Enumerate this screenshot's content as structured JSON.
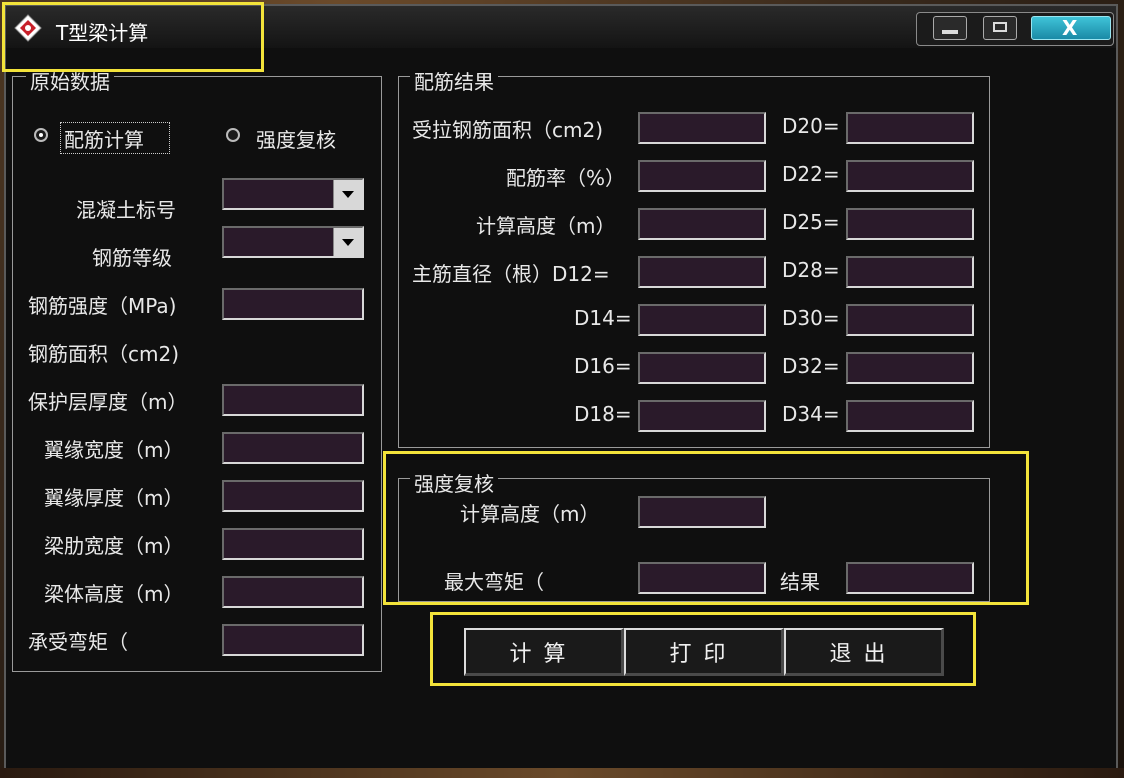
{
  "window": {
    "title": "T型梁计算",
    "minimize_label": "",
    "maximize_label": "",
    "close_label": "X"
  },
  "left_group": {
    "title": "原始数据",
    "radio_calc": "配筋计算",
    "radio_check": "强度复核",
    "concrete_grade": "混凝土标号",
    "steel_grade": "钢筋等级",
    "steel_strength": "钢筋强度（MPa)",
    "steel_area": "钢筋面积（cm2)",
    "cover_thickness": "保护层厚度（m）",
    "flange_width": "翼缘宽度（m）",
    "flange_thickness": "翼缘厚度（m）",
    "rib_width": "梁肋宽度（m）",
    "beam_height": "梁体高度（m）",
    "moment": "承受弯矩（"
  },
  "result_group": {
    "title": "配筋结果",
    "tension_area": "受拉钢筋面积（cm2)",
    "ratio": "配筋率（%）",
    "calc_height": "计算高度（m）",
    "main_bar": "主筋直径（根）D12=",
    "d14": "D14=",
    "d16": "D16=",
    "d18": "D18=",
    "d20": "D20=",
    "d22": "D22=",
    "d25": "D25=",
    "d28": "D28=",
    "d30": "D30=",
    "d32": "D32=",
    "d34": "D34="
  },
  "check_group": {
    "title": "强度复核",
    "calc_height": "计算高度（m）",
    "max_moment": "最大弯矩（",
    "result": "结果"
  },
  "buttons": {
    "calculate": "计算",
    "print": "打印",
    "exit": "退出"
  },
  "colors": {
    "field_bg": "#2a1a2a",
    "highlight": "#f3e33a",
    "close_button": "#1a8aa6"
  }
}
